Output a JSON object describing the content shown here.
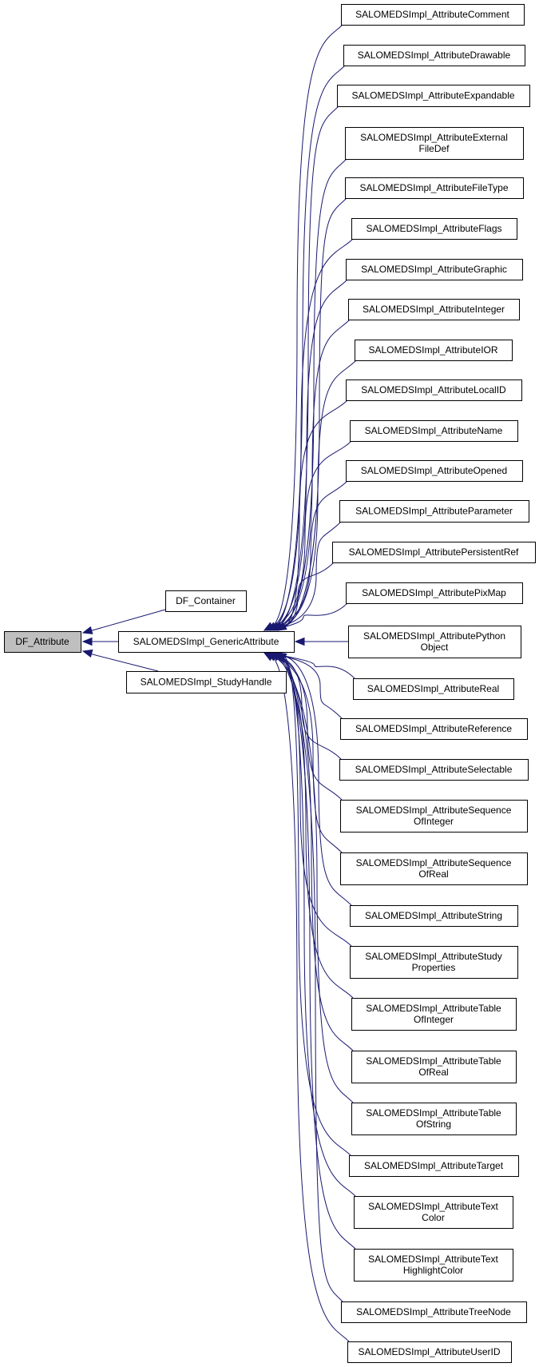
{
  "diagram": {
    "type": "inheritance-graph",
    "edge_color": "#191970",
    "root_fill": "#bfbfbf",
    "root": {
      "id": "df_attribute",
      "label": [
        "DF_Attribute"
      ]
    },
    "level1": [
      {
        "id": "df_container",
        "label": [
          "DF_Container"
        ],
        "parent": "df_attribute"
      },
      {
        "id": "generic_attribute",
        "label": [
          "SALOMEDSImpl_GenericAttribute"
        ],
        "parent": "df_attribute"
      },
      {
        "id": "study_handle",
        "label": [
          "SALOMEDSImpl_StudyHandle"
        ],
        "parent": "df_attribute"
      }
    ],
    "level2": [
      {
        "id": "attr_comment",
        "label": [
          "SALOMEDSImpl_AttributeComment"
        ],
        "parent": "generic_attribute"
      },
      {
        "id": "attr_drawable",
        "label": [
          "SALOMEDSImpl_AttributeDrawable"
        ],
        "parent": "generic_attribute"
      },
      {
        "id": "attr_expandable",
        "label": [
          "SALOMEDSImpl_AttributeExpandable"
        ],
        "parent": "generic_attribute"
      },
      {
        "id": "attr_external_file_def",
        "label": [
          "SALOMEDSImpl_AttributeExternal",
          "FileDef"
        ],
        "parent": "generic_attribute"
      },
      {
        "id": "attr_file_type",
        "label": [
          "SALOMEDSImpl_AttributeFileType"
        ],
        "parent": "generic_attribute"
      },
      {
        "id": "attr_flags",
        "label": [
          "SALOMEDSImpl_AttributeFlags"
        ],
        "parent": "generic_attribute"
      },
      {
        "id": "attr_graphic",
        "label": [
          "SALOMEDSImpl_AttributeGraphic"
        ],
        "parent": "generic_attribute"
      },
      {
        "id": "attr_integer",
        "label": [
          "SALOMEDSImpl_AttributeInteger"
        ],
        "parent": "generic_attribute"
      },
      {
        "id": "attr_ior",
        "label": [
          "SALOMEDSImpl_AttributeIOR"
        ],
        "parent": "generic_attribute"
      },
      {
        "id": "attr_local_id",
        "label": [
          "SALOMEDSImpl_AttributeLocalID"
        ],
        "parent": "generic_attribute"
      },
      {
        "id": "attr_name",
        "label": [
          "SALOMEDSImpl_AttributeName"
        ],
        "parent": "generic_attribute"
      },
      {
        "id": "attr_opened",
        "label": [
          "SALOMEDSImpl_AttributeOpened"
        ],
        "parent": "generic_attribute"
      },
      {
        "id": "attr_parameter",
        "label": [
          "SALOMEDSImpl_AttributeParameter"
        ],
        "parent": "generic_attribute"
      },
      {
        "id": "attr_persistent_ref",
        "label": [
          "SALOMEDSImpl_AttributePersistentRef"
        ],
        "parent": "generic_attribute"
      },
      {
        "id": "attr_pixmap",
        "label": [
          "SALOMEDSImpl_AttributePixMap"
        ],
        "parent": "generic_attribute"
      },
      {
        "id": "attr_python_object",
        "label": [
          "SALOMEDSImpl_AttributePython",
          "Object"
        ],
        "parent": "generic_attribute"
      },
      {
        "id": "attr_real",
        "label": [
          "SALOMEDSImpl_AttributeReal"
        ],
        "parent": "generic_attribute"
      },
      {
        "id": "attr_reference",
        "label": [
          "SALOMEDSImpl_AttributeReference"
        ],
        "parent": "generic_attribute"
      },
      {
        "id": "attr_selectable",
        "label": [
          "SALOMEDSImpl_AttributeSelectable"
        ],
        "parent": "generic_attribute"
      },
      {
        "id": "attr_sequence_of_integer",
        "label": [
          "SALOMEDSImpl_AttributeSequence",
          "OfInteger"
        ],
        "parent": "generic_attribute"
      },
      {
        "id": "attr_sequence_of_real",
        "label": [
          "SALOMEDSImpl_AttributeSequence",
          "OfReal"
        ],
        "parent": "generic_attribute"
      },
      {
        "id": "attr_string",
        "label": [
          "SALOMEDSImpl_AttributeString"
        ],
        "parent": "generic_attribute"
      },
      {
        "id": "attr_study_properties",
        "label": [
          "SALOMEDSImpl_AttributeStudy",
          "Properties"
        ],
        "parent": "generic_attribute"
      },
      {
        "id": "attr_table_of_integer",
        "label": [
          "SALOMEDSImpl_AttributeTable",
          "OfInteger"
        ],
        "parent": "generic_attribute"
      },
      {
        "id": "attr_table_of_real",
        "label": [
          "SALOMEDSImpl_AttributeTable",
          "OfReal"
        ],
        "parent": "generic_attribute"
      },
      {
        "id": "attr_table_of_string",
        "label": [
          "SALOMEDSImpl_AttributeTable",
          "OfString"
        ],
        "parent": "generic_attribute"
      },
      {
        "id": "attr_target",
        "label": [
          "SALOMEDSImpl_AttributeTarget"
        ],
        "parent": "generic_attribute"
      },
      {
        "id": "attr_text_color",
        "label": [
          "SALOMEDSImpl_AttributeText",
          "Color"
        ],
        "parent": "generic_attribute"
      },
      {
        "id": "attr_text_highlight_color",
        "label": [
          "SALOMEDSImpl_AttributeText",
          "HighlightColor"
        ],
        "parent": "generic_attribute"
      },
      {
        "id": "attr_tree_node",
        "label": [
          "SALOMEDSImpl_AttributeTreeNode"
        ],
        "parent": "generic_attribute"
      },
      {
        "id": "attr_user_id",
        "label": [
          "SALOMEDSImpl_AttributeUserID"
        ],
        "parent": "generic_attribute"
      }
    ]
  }
}
